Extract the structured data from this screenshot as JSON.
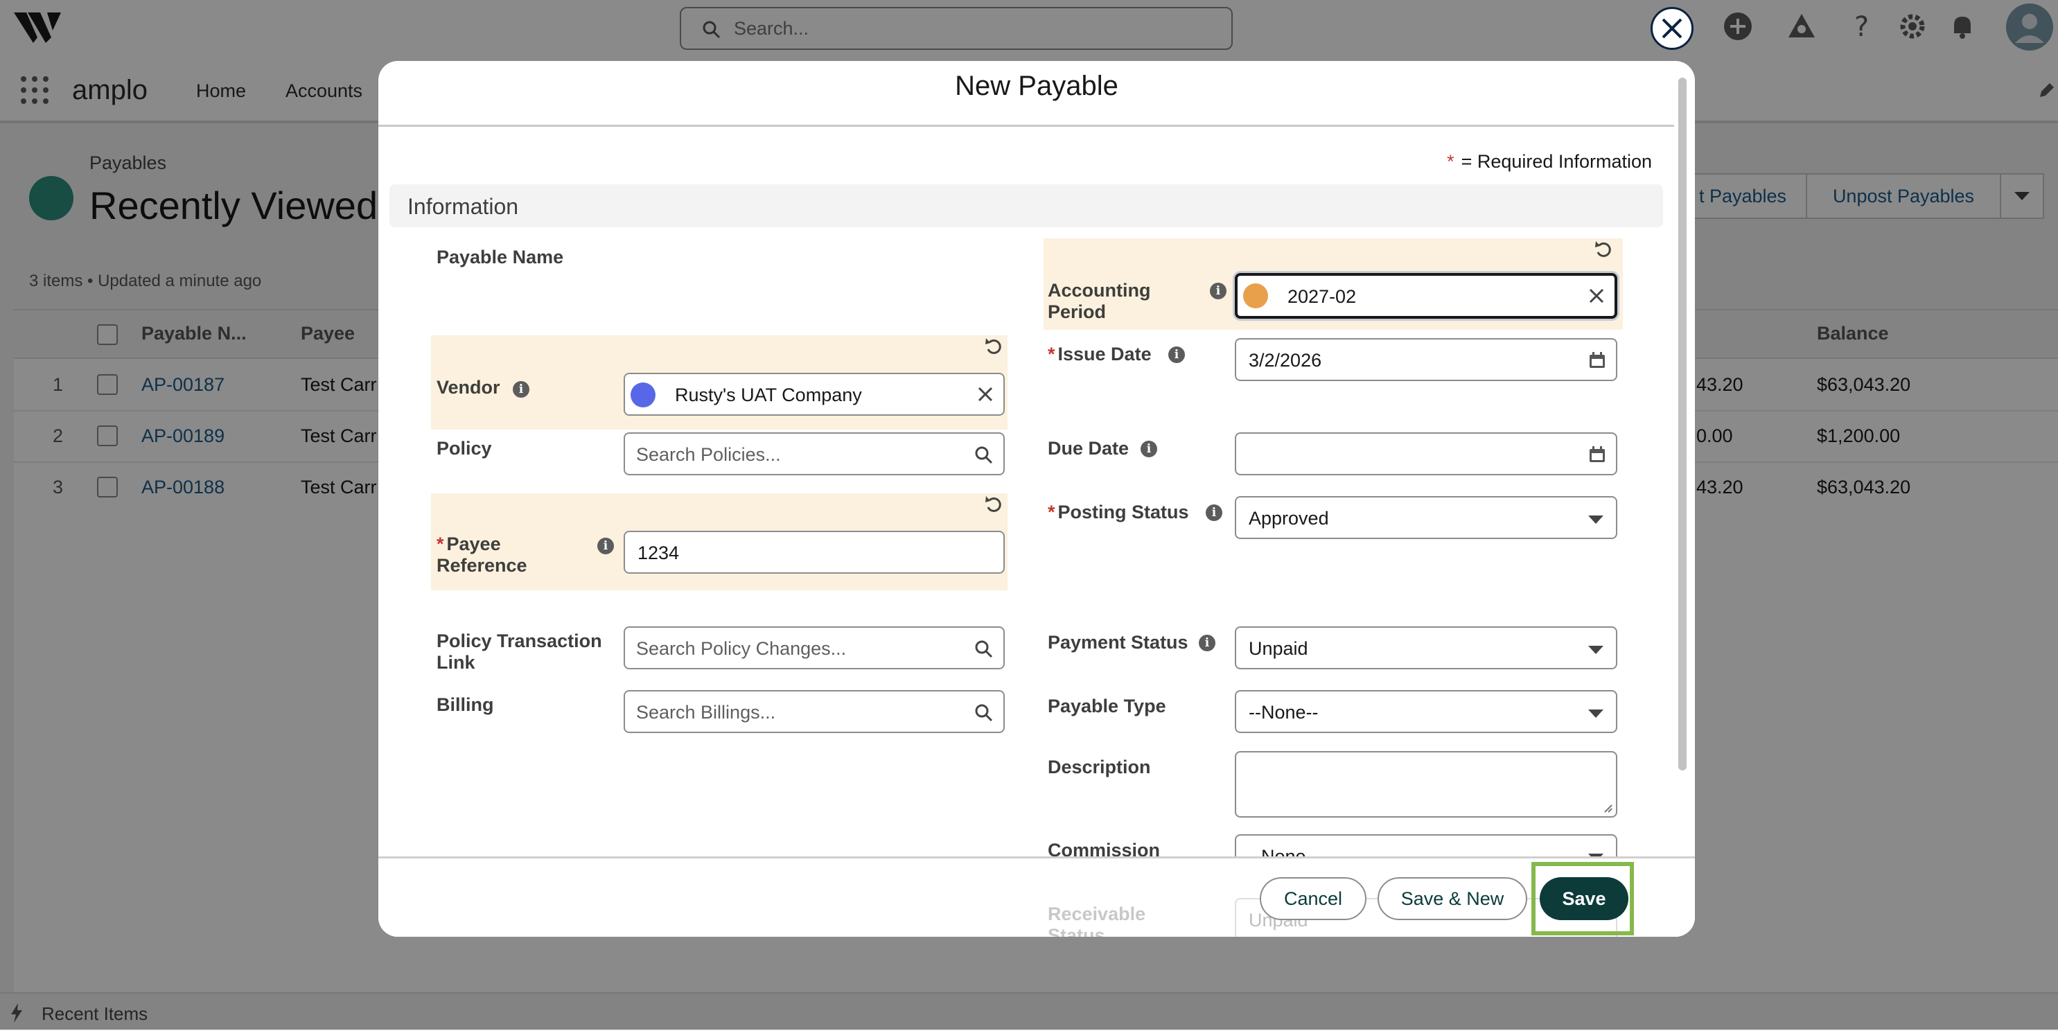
{
  "topbar": {
    "search_placeholder": "Search..."
  },
  "nav": {
    "app_name": "amplo",
    "tabs": [
      "Home",
      "Accounts"
    ]
  },
  "list": {
    "breadcrumb": "Payables",
    "title": "Recently Viewed",
    "meta": "3 items • Updated a minute ago",
    "buttons": [
      "t Payables",
      "Unpost Payables"
    ],
    "columns": [
      "Payable N...",
      "Payee",
      "Balance"
    ],
    "rows": [
      {
        "num": "1",
        "name": "AP-00187",
        "payee": "Test Carr",
        "amount": "43.20",
        "balance": "$63,043.20"
      },
      {
        "num": "2",
        "name": "AP-00189",
        "payee": "Test Carr",
        "amount": "0.00",
        "balance": "$1,200.00"
      },
      {
        "num": "3",
        "name": "AP-00188",
        "payee": "Test Carr",
        "amount": "43.20",
        "balance": "$63,043.20"
      }
    ]
  },
  "footer": {
    "recent_items": "Recent Items"
  },
  "modal": {
    "title": "New Payable",
    "required_star": "*",
    "required_note": "= Required Information",
    "section_title": "Information",
    "left": {
      "payable_name_label": "Payable Name",
      "vendor_label": "Vendor",
      "vendor_value": "Rusty's UAT Company",
      "policy_label": "Policy",
      "policy_placeholder": "Search Policies...",
      "payee_ref_label": "Payee Reference",
      "payee_ref_value": "1234",
      "policy_tx_label": "Policy Transaction Link",
      "policy_tx_placeholder": "Search Policy Changes...",
      "billing_label": "Billing",
      "billing_placeholder": "Search Billings..."
    },
    "right": {
      "accounting_period_label": "Accounting Period",
      "accounting_period_value": "2027-02",
      "issue_date_label": "Issue Date",
      "issue_date_value": "3/2/2026",
      "due_date_label": "Due Date",
      "due_date_value": "",
      "posting_status_label": "Posting Status",
      "posting_status_value": "Approved",
      "payment_status_label": "Payment Status",
      "payment_status_value": "Unpaid",
      "payable_type_label": "Payable Type",
      "payable_type_value": "--None--",
      "description_label": "Description",
      "commission_type_label": "Commission Type",
      "commission_type_value": "--None--",
      "receivable_status_label": "Receivable Status",
      "receivable_status_value": "Unpaid"
    },
    "buttons": {
      "cancel": "Cancel",
      "save_new": "Save & New",
      "save": "Save"
    }
  },
  "colors": {
    "highlight_bg": "#fbf1de",
    "save_button": "#0c3b3a",
    "save_outline": "#86b84b",
    "required": "#c23934"
  }
}
